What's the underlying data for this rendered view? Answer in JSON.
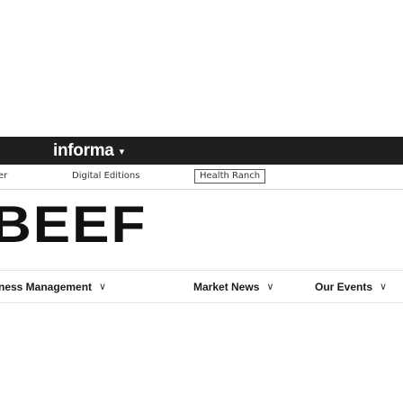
{
  "header": {
    "brand": "informa",
    "brand_caret": "▾"
  },
  "sub_links": {
    "partial": "er",
    "digital": "Digital Editions",
    "boxed": "Health Ranch"
  },
  "logo": {
    "text": "BEEF"
  },
  "nav": {
    "items": [
      {
        "label": "ness Management",
        "chevron": "∨"
      },
      {
        "label": "Market News",
        "chevron": "∨"
      },
      {
        "label": "Our Events",
        "chevron": "∨"
      }
    ]
  },
  "colors": {
    "top_bar": "#1f1f1f",
    "text": "#1a1a1a"
  }
}
